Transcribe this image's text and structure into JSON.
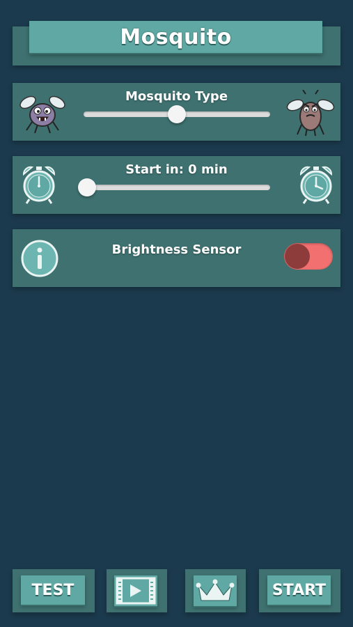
{
  "header": {
    "title": "Mosquito"
  },
  "mosquito_type": {
    "label": "Mosquito Type",
    "left_icon": "cute-mosquito-icon",
    "right_icon": "angry-mosquito-icon",
    "slider_value": 0.5
  },
  "start_timer": {
    "label": "Start in: 0 min",
    "left_icon": "alarm-clock-icon",
    "right_icon": "alarm-clock-icon",
    "slider_value": 0.0
  },
  "brightness": {
    "info_icon": "info-icon",
    "label": "Brightness Sensor",
    "toggle_on": false
  },
  "bottom_bar": {
    "test_label": "TEST",
    "video_icon": "video-play-icon",
    "crown_icon": "crown-icon",
    "start_label": "START"
  },
  "colors": {
    "background": "#1b3a4d",
    "panel": "#3e7170",
    "button": "#5fa8a3",
    "toggle_track": "#f27070",
    "toggle_knob": "#8e3b3b"
  }
}
